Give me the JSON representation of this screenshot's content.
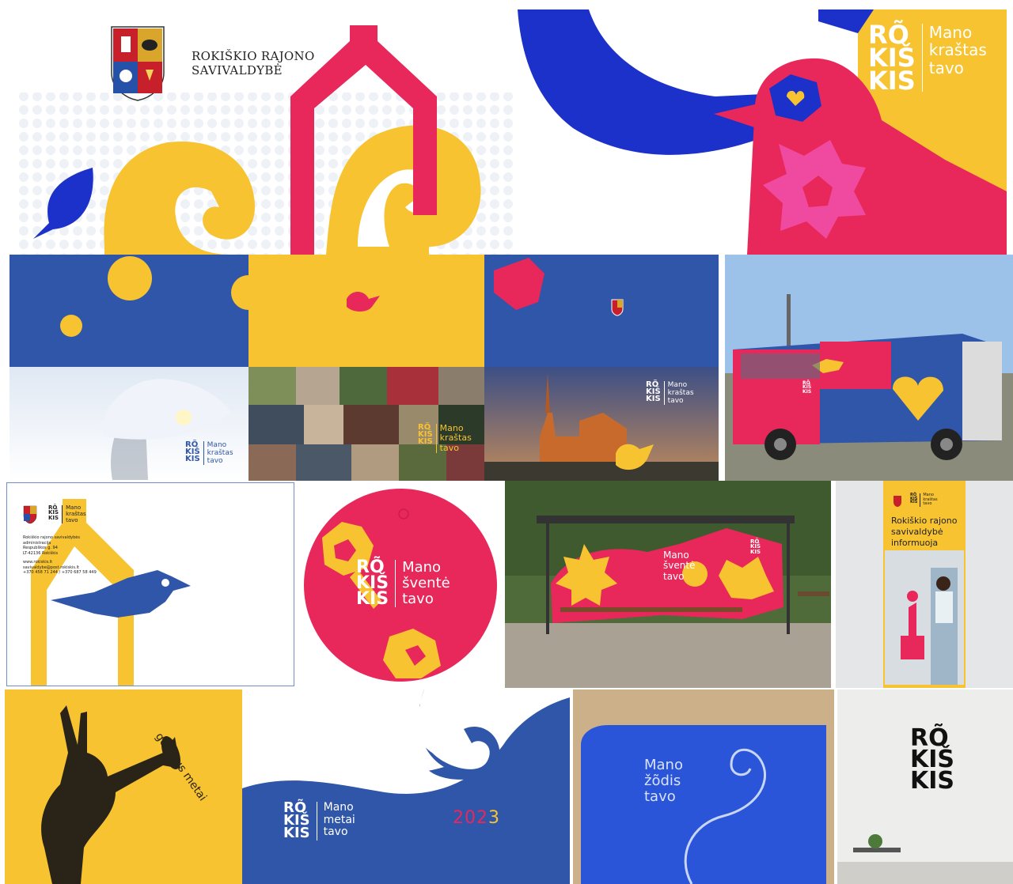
{
  "colors": {
    "yellow": "#f8c331",
    "pink": "#e8285a",
    "blue": "#1c31c9",
    "navy": "#2f56a8",
    "hot_pink": "#f04aa0",
    "white": "#ffffff"
  },
  "brand": {
    "logo_lines": [
      "RÕ",
      "KIŠ",
      "KIS"
    ],
    "logo_alt": "Rokiškis"
  },
  "top_left": {
    "municipality_line1": "ROKIŠKIO RAJONO",
    "municipality_line2": "SAVIVALDYBĖ"
  },
  "top_right": {
    "slogan_line1": "Mano",
    "slogan_line2": "kraštas",
    "slogan_line3": "tavo"
  },
  "winter": {
    "slogan_line1": "Mano",
    "slogan_line2": "kraštas",
    "slogan_line3": "tavo"
  },
  "crowd": {
    "slogan_line1": "Mano",
    "slogan_line2": "kraštas",
    "slogan_line3": "tavo"
  },
  "church": {
    "slogan_line1": "Mano",
    "slogan_line2": "kraštas",
    "slogan_line3": "tavo"
  },
  "letterhead": {
    "slogan_line1": "Mano",
    "slogan_line2": "kraštas",
    "slogan_line3": "tavo",
    "address_line1": "Rokiškio rajono savivaldybės",
    "address_line2": "administracija",
    "address_line3": "Respublikos g. 94",
    "address_line4": "LT-42136 Rokiškis",
    "web": "www.rokiskis.lt",
    "email": "savivaldybe@post.rokiskis.lt",
    "phone": "+370 458 71 244 / +370 687 58 449"
  },
  "circle": {
    "slogan_line1": "Mano",
    "slogan_line2": "šventė",
    "slogan_line3": "tavo"
  },
  "shelter": {
    "slogan_line1": "Mano",
    "slogan_line2": "šventė",
    "slogan_line3": "tavo"
  },
  "rollup": {
    "slogan_line1": "Mano",
    "slogan_line2": "kraštas",
    "slogan_line3": "tavo",
    "headline_line1": "Rokiškio rajono",
    "headline_line2": "savivaldybė",
    "headline_line3": "informuoja"
  },
  "hare": {
    "tagline": "geri bus metai"
  },
  "year_card": {
    "slogan_line1": "Mano",
    "slogan_line2": "metai",
    "slogan_line3": "tavo",
    "year_part1": "202",
    "year_part2": "3"
  },
  "leather": {
    "slogan_line1": "Mano",
    "slogan_line2": "žõdis",
    "slogan_line3": "tavo"
  }
}
